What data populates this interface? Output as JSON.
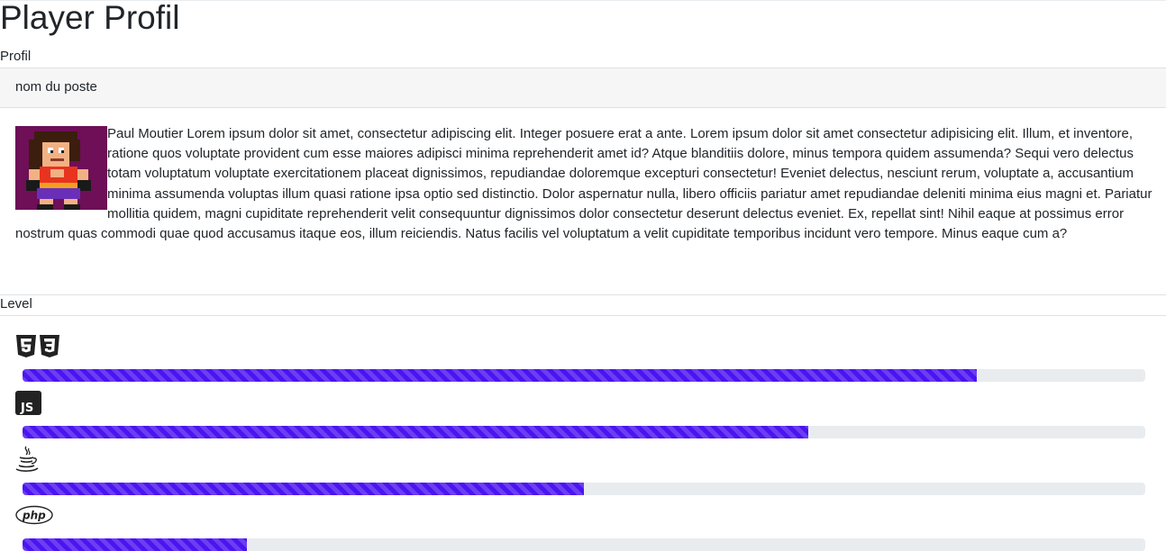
{
  "page": {
    "title": "Player Profil"
  },
  "profile": {
    "section_label": "Profil",
    "card_header": "nom du poste",
    "bio": "Paul Moutier Lorem ipsum dolor sit amet, consectetur adipiscing elit. Integer posuere erat a ante. Lorem ipsum dolor sit amet consectetur adipisicing elit. Illum, et inventore, ratione quos voluptate provident cum esse maiores adipisci minima reprehenderit amet id? Atque blanditiis dolore, minus tempora quidem assumenda? Sequi vero delectus totam voluptatum voluptate exercitationem placeat dignissimos, repudiandae doloremque excepturi consectetur! Eveniet delectus, nesciunt rerum, voluptate a, accusantium minima assumenda voluptas illum quasi ratione ipsa optio sed distinctio. Dolor aspernatur nulla, libero officiis pariatur amet repudiandae deleniti minima eius magni et. Pariatur mollitia quidem, magni cupiditate reprehenderit velit consequuntur dignissimos dolor consectetur deserunt delectus eveniet. Ex, repellat sint! Nihil eaque at possimus error nostrum quas commodi quae quod accusamus itaque eos, illum reiciendis. Natus facilis vel voluptatum a velit cupiditate temporibus incidunt vero tempore. Minus eaque cum a?",
    "avatar_icon": "pixel-character-avatar"
  },
  "level": {
    "section_label": "Level",
    "bar_color": "#4b14f0",
    "track_color": "#e9ecef",
    "skills": [
      {
        "icon": "html5-css3-icon",
        "progress": 0.85
      },
      {
        "icon": "javascript-icon",
        "progress": 0.7
      },
      {
        "icon": "java-icon",
        "progress": 0.5
      },
      {
        "icon": "php-icon",
        "progress": 0.2
      }
    ]
  }
}
